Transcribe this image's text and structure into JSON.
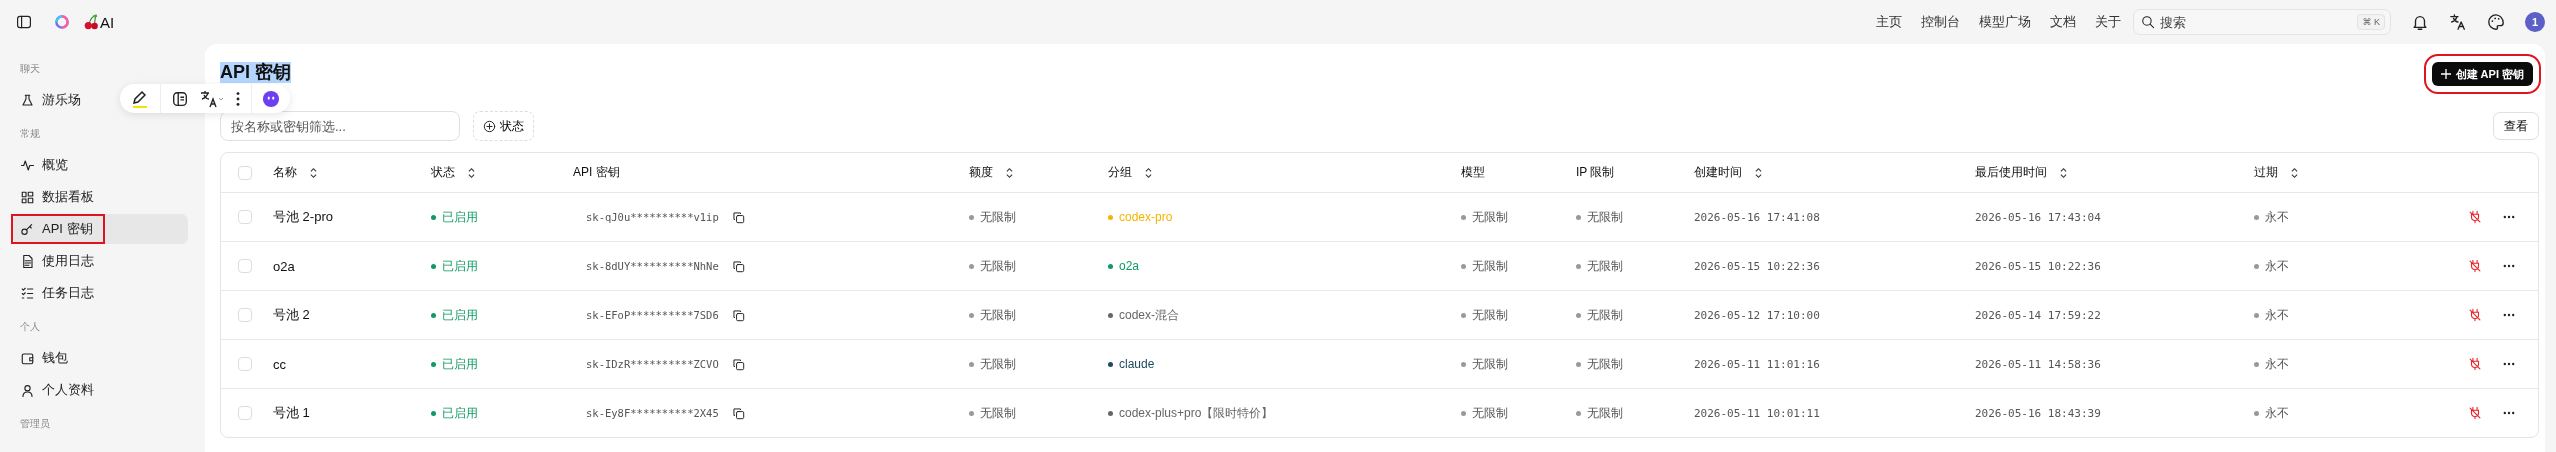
{
  "topbar": {
    "brand": "AI",
    "nav": [
      "主页",
      "控制台",
      "模型广场",
      "文档",
      "关于"
    ],
    "search": {
      "placeholder": "搜索",
      "shortcut": "⌘ K"
    },
    "avatar": "1"
  },
  "sidebar": {
    "sections": [
      {
        "title": "聊天",
        "items": [
          {
            "label": "游乐场",
            "selected": false,
            "highlighted": false
          }
        ]
      },
      {
        "title": "常规",
        "items": [
          {
            "label": "概览",
            "selected": false,
            "highlighted": false
          },
          {
            "label": "数据看板",
            "selected": false,
            "highlighted": false
          },
          {
            "label": "API 密钥",
            "selected": true,
            "highlighted": true
          },
          {
            "label": "使用日志",
            "selected": false,
            "highlighted": false
          },
          {
            "label": "任务日志",
            "selected": false,
            "highlighted": false
          }
        ]
      },
      {
        "title": "个人",
        "items": [
          {
            "label": "钱包",
            "selected": false,
            "highlighted": false
          },
          {
            "label": "个人资料",
            "selected": false,
            "highlighted": false
          }
        ]
      },
      {
        "title": "管理员"
      }
    ]
  },
  "page": {
    "title": "API 密钥",
    "title_selected": true,
    "create_button": {
      "label": "创建 API 密钥",
      "highlighted": true
    },
    "filter": {
      "placeholder": "按名称或密钥筛选..."
    },
    "status_filter": "状态",
    "view_button": "查看"
  },
  "table": {
    "select_all": {
      "checked": false
    },
    "columns": [
      {
        "label": "名称",
        "sortable": true
      },
      {
        "label": "状态",
        "sortable": true
      },
      {
        "label": "API 密钥",
        "sortable": false
      },
      {
        "label": "额度",
        "sortable": true
      },
      {
        "label": "分组",
        "sortable": true
      },
      {
        "label": "模型",
        "sortable": false
      },
      {
        "label": "IP 限制",
        "sortable": false
      },
      {
        "label": "创建时间",
        "sortable": true
      },
      {
        "label": "最后使用时间",
        "sortable": true
      },
      {
        "label": "过期",
        "sortable": true
      }
    ],
    "rows": [
      {
        "checked": false,
        "name": "号池 2-pro",
        "status": "已启用",
        "key": "sk-qJ0u**********v1ip",
        "quota": "无限制",
        "group": {
          "label": "codex-pro",
          "color": "#f5b400"
        },
        "model": "无限制",
        "ip": "无限制",
        "created": "2026-05-16 17:41:08",
        "last_used": "2026-05-16 17:43:04",
        "expires": "永不"
      },
      {
        "checked": false,
        "name": "o2a",
        "status": "已启用",
        "key": "sk-8dUY**********NhNe",
        "quota": "无限制",
        "group": {
          "label": "o2a",
          "color": "#0e9a63"
        },
        "model": "无限制",
        "ip": "无限制",
        "created": "2026-05-15 10:22:36",
        "last_used": "2026-05-15 10:22:36",
        "expires": "永不"
      },
      {
        "checked": false,
        "name": "号池 2",
        "status": "已启用",
        "key": "sk-EFoP**********7SD6",
        "quota": "无限制",
        "group": {
          "label": "codex-混合",
          "color": "#666666"
        },
        "model": "无限制",
        "ip": "无限制",
        "created": "2026-05-12 17:10:00",
        "last_used": "2026-05-14 17:59:22",
        "expires": "永不"
      },
      {
        "checked": false,
        "name": "cc",
        "status": "已启用",
        "key": "sk-IDzR**********ZCVO",
        "quota": "无限制",
        "group": {
          "label": "claude",
          "color": "#1d4b5f"
        },
        "model": "无限制",
        "ip": "无限制",
        "created": "2026-05-11 11:01:16",
        "last_used": "2026-05-11 14:58:36",
        "expires": "永不"
      },
      {
        "checked": false,
        "name": "号池 1",
        "status": "已启用",
        "key": "sk-Ey8F**********2X45",
        "quota": "无限制",
        "group": {
          "label": "codex-plus+pro【限时特价】",
          "color": "#666666"
        },
        "model": "无限制",
        "ip": "无限制",
        "created": "2026-05-11 10:01:11",
        "last_used": "2026-05-16 18:43:39",
        "expires": "永不"
      }
    ]
  }
}
